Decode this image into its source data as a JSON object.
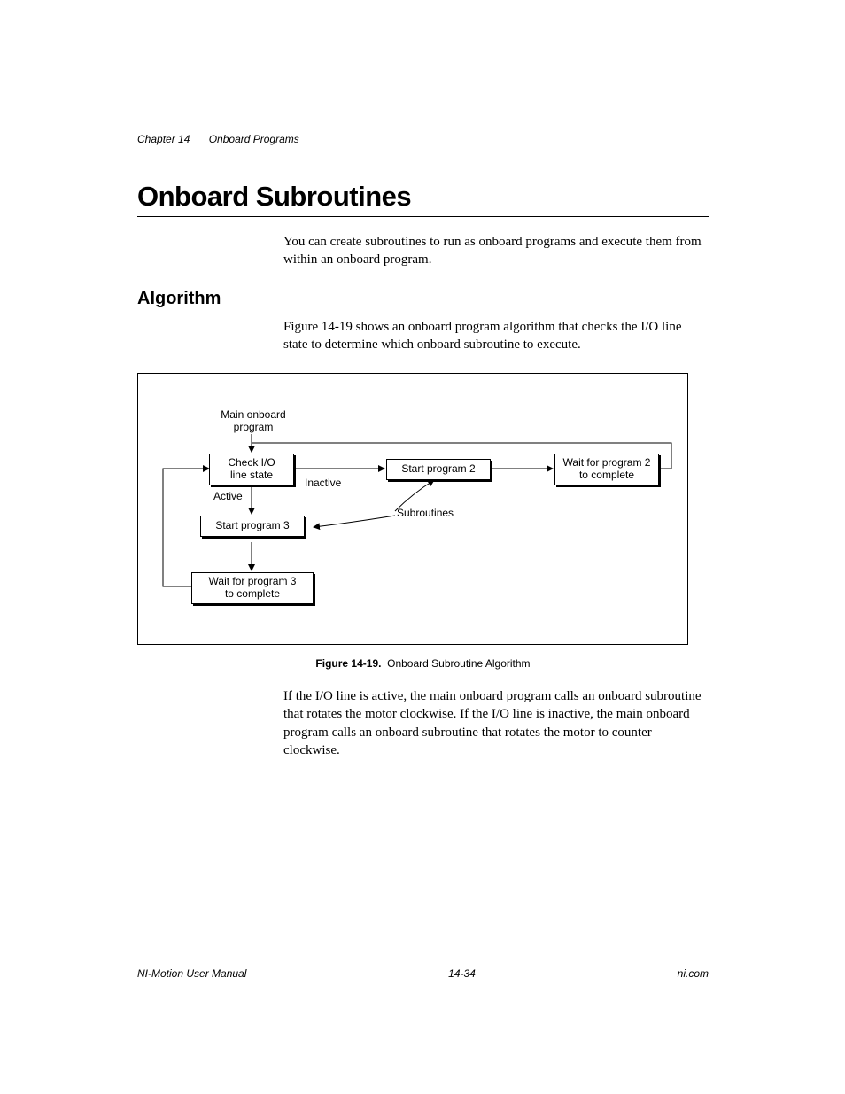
{
  "header": {
    "chapter": "Chapter 14",
    "chapter_title": "Onboard Programs"
  },
  "title": "Onboard Subroutines",
  "intro": "You can create subroutines to run as onboard programs and execute them from within an onboard program.",
  "subhead": "Algorithm",
  "algo_intro": "Figure 14-19 shows an onboard program algorithm that checks the I/O line state to determine which onboard subroutine to execute.",
  "flowchart": {
    "main_label": "Main onboard\nprogram",
    "check_io": "Check I/O\nline state",
    "inactive": "Inactive",
    "active": "Active",
    "start2": "Start program 2",
    "wait2": "Wait for program 2\nto complete",
    "start3": "Start program 3",
    "wait3": "Wait for program 3\nto complete",
    "subroutines": "Subroutines"
  },
  "caption": {
    "number": "Figure 14-19.",
    "text": "Onboard Subroutine Algorithm"
  },
  "after_figure": "If the I/O line is active, the main onboard program calls an onboard subroutine that rotates the motor clockwise. If the I/O line is inactive, the main onboard program calls an onboard subroutine that rotates the motor to counter clockwise.",
  "footer": {
    "left": "NI-Motion User Manual",
    "center": "14-34",
    "right": "ni.com"
  }
}
